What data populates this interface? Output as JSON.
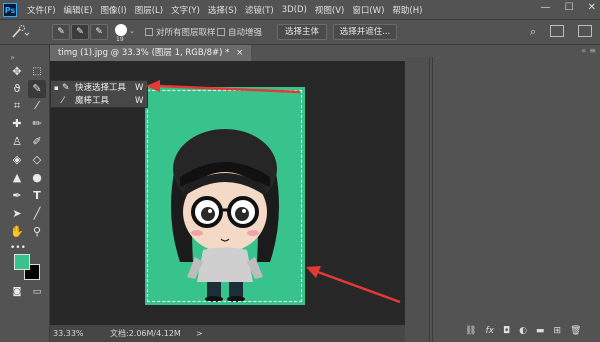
{
  "app": {
    "logo": "Ps"
  },
  "menubar": {
    "items": [
      "文件(F)",
      "编辑(E)",
      "图像(I)",
      "图层(L)",
      "文字(Y)",
      "选择(S)",
      "滤镜(T)",
      "3D(D)",
      "视图(V)",
      "窗口(W)",
      "帮助(H)"
    ]
  },
  "window_controls": {
    "minimize": "—",
    "maximize": "☐",
    "close": "✕"
  },
  "options_bar": {
    "brush_size": "19",
    "sample_all_layers": "对所有图层取样",
    "auto_enhance": "自动增强",
    "select_subject": "选择主体",
    "select_and_mask": "选择并遮住..."
  },
  "document": {
    "tab_title": "timg (1).jpg @ 33.3% (图层 1, RGB/8#) *",
    "tab_close": "×"
  },
  "flyout": {
    "items": [
      {
        "label": "快速选择工具",
        "shortcut": "W",
        "active": true
      },
      {
        "label": "魔棒工具",
        "shortcut": "W",
        "active": false
      }
    ]
  },
  "status": {
    "zoom": "33.33%",
    "doc_size": "文档:2.06M/4.12M",
    "arrow": ">"
  },
  "colors": {
    "foreground": "#38c38c",
    "background": "#000000",
    "arrow": "#e53935"
  },
  "icons": [
    "move-icon",
    "marquee-icon",
    "lasso-icon",
    "quick-select-icon",
    "crop-icon",
    "eyedropper-icon",
    "healing-icon",
    "brush-icon",
    "stamp-icon",
    "history-brush-icon",
    "eraser-icon",
    "bucket-icon",
    "blur-icon",
    "dodge-icon",
    "pen-icon",
    "type-icon",
    "path-select-icon",
    "line-icon",
    "hand-icon",
    "zoom-icon",
    "more-icon"
  ],
  "layers_panel_icons": [
    "link-icon",
    "fx-icon",
    "mask-icon",
    "adjustment-icon",
    "group-icon",
    "new-layer-icon",
    "trash-icon"
  ]
}
